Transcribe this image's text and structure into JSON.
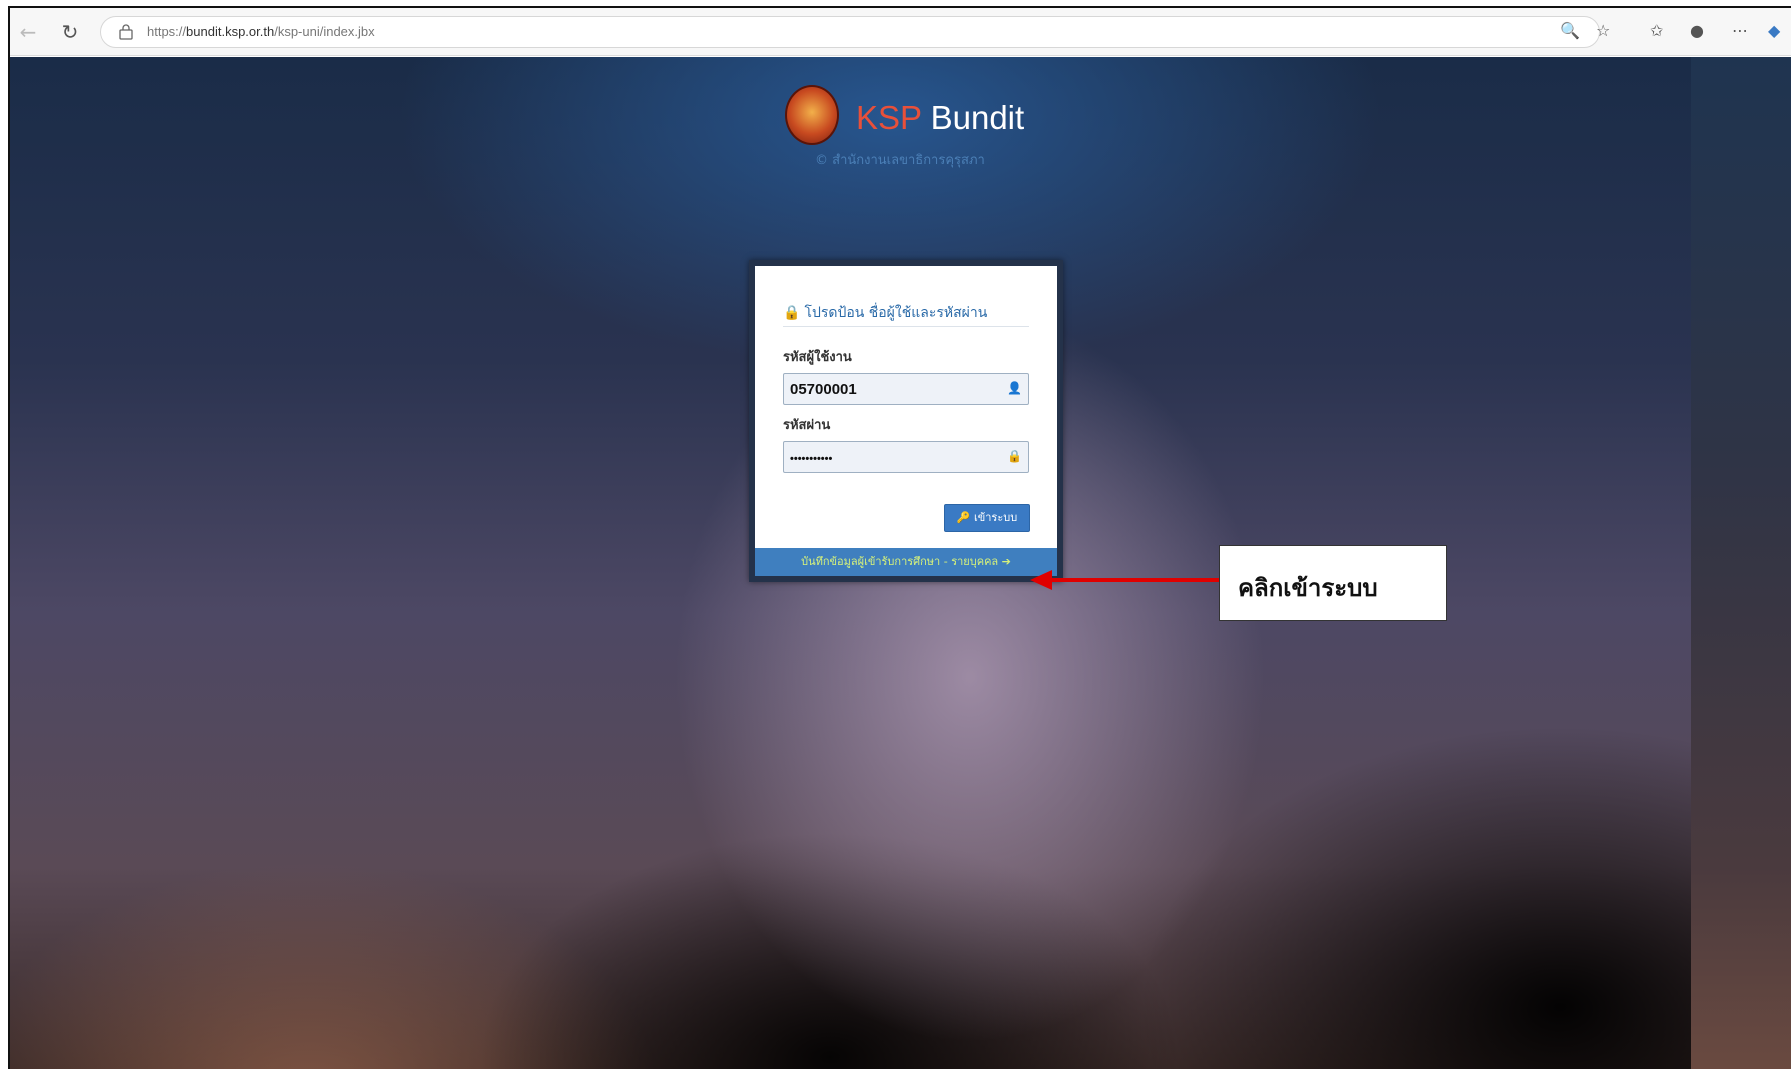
{
  "browser": {
    "url_prefix": "https://",
    "url_host": "bundit.ksp.or.th",
    "url_path": "/ksp-uni/index.jbx"
  },
  "logo": {
    "title_ksp": "KSP",
    "title_bundit": "Bundit",
    "subtitle": "© สำนักงานเลขาธิการคุรุสภา"
  },
  "login": {
    "heading": "โปรดป้อน ชื่อผู้ใช้และรหัสผ่าน",
    "username_label": "รหัสผู้ใช้งาน",
    "username_value": "05700001",
    "password_label": "รหัสผ่าน",
    "password_value": "•••••••••••",
    "submit_label": "เข้าระบบ",
    "footer_link": "บันทึกข้อมูลผู้เข้ารับการศึกษา - รายบุคคล"
  },
  "annotation": {
    "callout_text": "คลิกเข้าระบบ",
    "arrow_color": "#e00000"
  },
  "colors": {
    "brand_red": "#e8503a",
    "button_blue": "#3a7ac4",
    "footer_blue": "#3f7fbf"
  }
}
